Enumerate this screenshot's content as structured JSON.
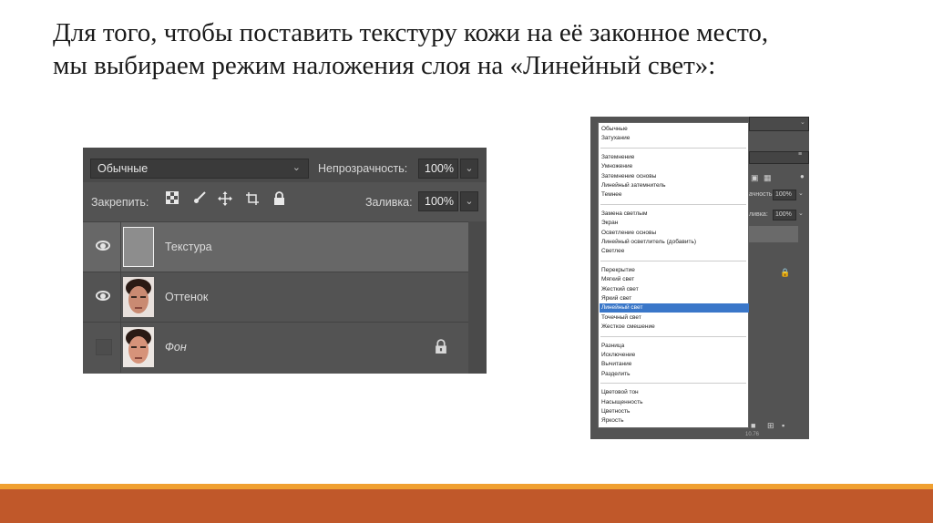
{
  "caption": {
    "line1": "Для того, чтобы поставить текстуру кожи на её законное место,",
    "line2": "мы выбираем режим наложения слоя на «Линейный свет»:"
  },
  "layers_panel": {
    "blend_mode": "Обычные",
    "opacity_label": "Непрозрачность:",
    "opacity_value": "100%",
    "lock_label": "Закрепить:",
    "fill_label": "Заливка:",
    "fill_value": "100%",
    "lock_icons": [
      "checker-lock-icon",
      "brush-icon",
      "move-icon",
      "crop-icon",
      "padlock-icon"
    ],
    "layers": [
      {
        "name": "Текстура",
        "visible": true,
        "selected": true
      },
      {
        "name": "Оттенок",
        "visible": true,
        "selected": false
      },
      {
        "name": "Фон",
        "visible": false,
        "selected": false,
        "locked": true
      }
    ]
  },
  "blend_menu": {
    "groups": [
      [
        "Обычные",
        "Затухание"
      ],
      [
        "Затемнение",
        "Умножение",
        "Затемнение основы",
        "Линейный затемнитель",
        "Темнее"
      ],
      [
        "Замена светлым",
        "Экран",
        "Осветление основы",
        "Линейный осветлитель (добавить)",
        "Светлее"
      ],
      [
        "Перекрытие",
        "Мягкий свет",
        "Жесткий свет",
        "Яркий свет",
        "Линейный свет",
        "Точечный свет",
        "Жесткое смешение"
      ],
      [
        "Разница",
        "Исключение",
        "Вычитание",
        "Разделить"
      ],
      [
        "Цветовой тон",
        "Насыщенность",
        "Цветность",
        "Яркость"
      ]
    ],
    "highlighted": "Линейный свет",
    "side_opacity_label": "ачность:",
    "side_opacity_value": "100%",
    "side_fill_label": "ливка:",
    "side_fill_value": "100%",
    "side_bottom_text": "10.76"
  },
  "colors": {
    "panel_bg": "#535353",
    "selected_layer": "#676767",
    "menu_highlight": "#3a77c9",
    "stripe_orange": "#f0a030",
    "stripe_rust": "#c0582a"
  }
}
